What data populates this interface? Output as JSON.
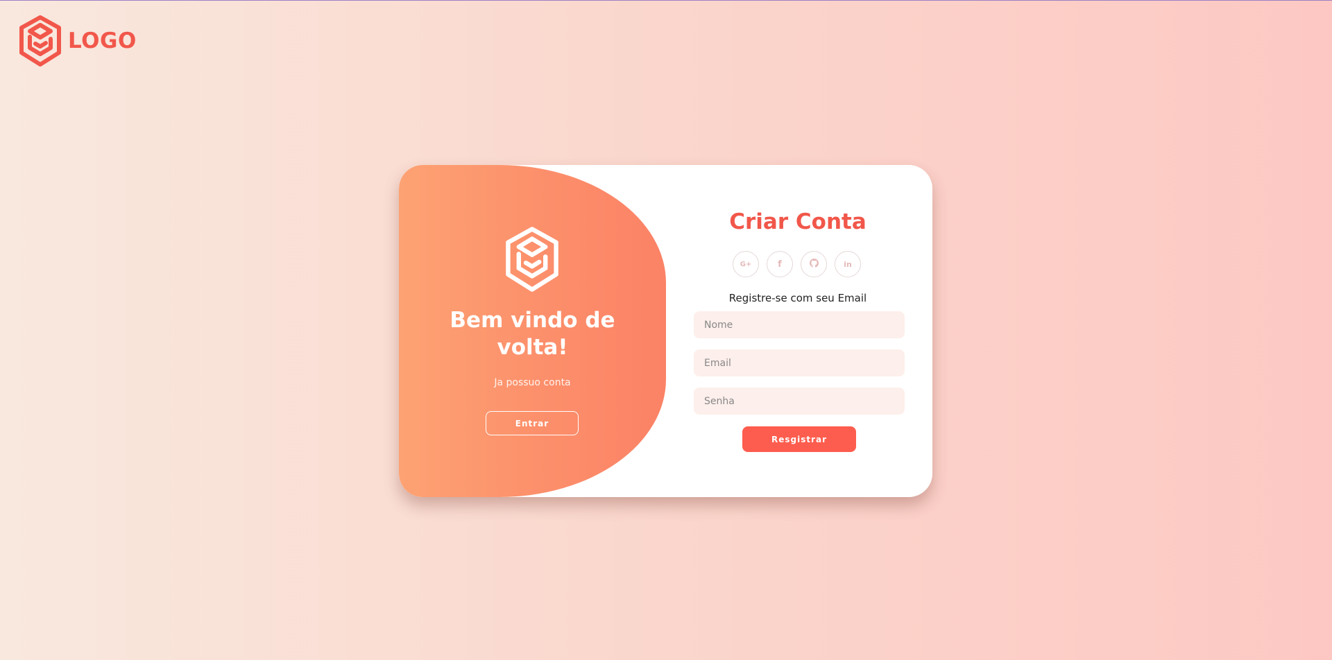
{
  "header": {
    "logo_text": "LOGO",
    "logo_icon": "hexagon-logo-icon"
  },
  "welcome_panel": {
    "title": "Bem vindo de volta!",
    "subtitle": "Ja possuo conta",
    "button_label": "Entrar",
    "logo_icon": "hexagon-logo-icon"
  },
  "register_form": {
    "title": "Criar Conta",
    "social_buttons": [
      {
        "name": "google-plus-icon",
        "glyph": "G+"
      },
      {
        "name": "facebook-icon",
        "glyph": "f"
      },
      {
        "name": "github-icon",
        "glyph": "github"
      },
      {
        "name": "linkedin-icon",
        "glyph": "in"
      }
    ],
    "subtitle": "Registre-se com seu Email",
    "fields": {
      "name_placeholder": "Nome",
      "email_placeholder": "Email",
      "password_placeholder": "Senha"
    },
    "submit_label": "Resgistrar"
  },
  "colors": {
    "accent": "#f1574a",
    "button": "#fd5d4e",
    "panel_start": "#fda273",
    "panel_end": "#fb8266",
    "input_bg": "#fdefeb"
  }
}
